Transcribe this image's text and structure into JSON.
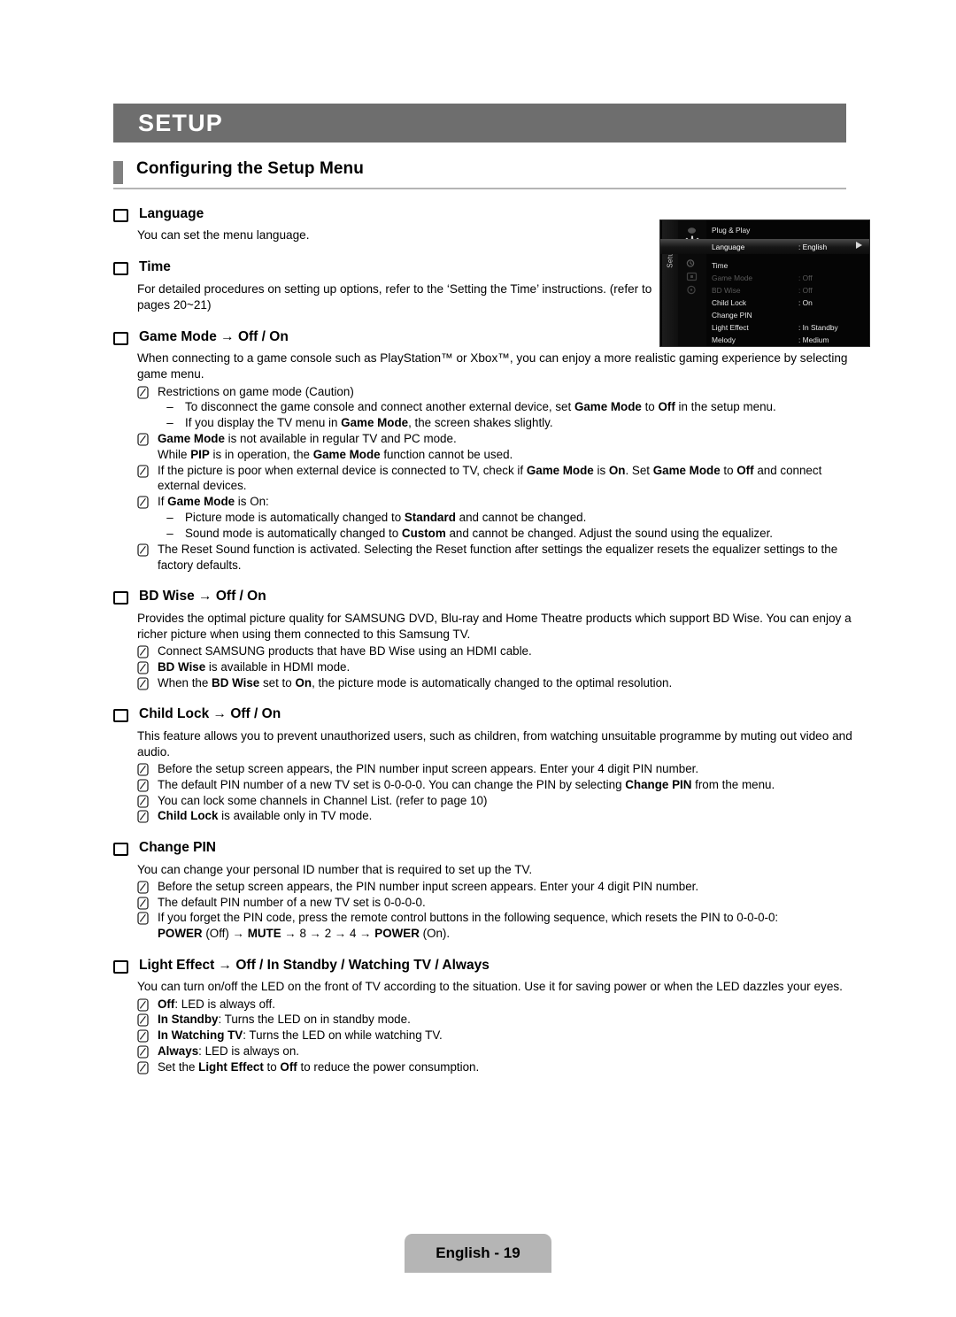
{
  "chapter": {
    "title": "SETUP"
  },
  "section": {
    "title": "Configuring the Setup Menu"
  },
  "footer": {
    "page_label": "English - 19"
  },
  "osd": {
    "tab_label": "Setup",
    "rows": [
      {
        "label": "Plug & Play",
        "value": "",
        "state": "normal"
      },
      {
        "label": "Language",
        "value": ": English",
        "state": "selected"
      },
      {
        "label": "Time",
        "value": "",
        "state": "normal"
      },
      {
        "label": "Game Mode",
        "value": ": Off",
        "state": "dim"
      },
      {
        "label": "BD Wise",
        "value": ": Off",
        "state": "dim"
      },
      {
        "label": "Child Lock",
        "value": ": On",
        "state": "normal"
      },
      {
        "label": "Change PIN",
        "value": "",
        "state": "normal"
      },
      {
        "label": "Light Effect",
        "value": ": In Standby",
        "state": "normal"
      },
      {
        "label": "Melody",
        "value": ": Medium",
        "state": "normal"
      }
    ]
  },
  "items": {
    "language": {
      "heading": "Language",
      "para": "You can set the menu language."
    },
    "time": {
      "heading": "Time",
      "para": "For detailed procedures on setting up options, refer to the ‘Setting the Time’ instructions. (refer to pages 20~21)"
    },
    "game_mode": {
      "heading": "Game Mode → Off / On",
      "para": "When connecting to a game console such as PlayStation™ or Xbox™, you can enjoy a more realistic gaming experience by selecting game menu.",
      "note1": "Restrictions on game mode (Caution)",
      "dash1": "To disconnect the game console and connect another external device, set Game Mode to Off in the setup menu.",
      "dash2": "If you display the TV menu in Game Mode, the screen shakes slightly.",
      "note2": "Game Mode is not available in regular TV and PC mode.",
      "note2b": "While PIP is in operation, the Game Mode function cannot be used.",
      "note3": "If the picture is poor when external device is connected to TV, check if Game Mode is On. Set Game Mode to Off and connect external devices.",
      "note4": "If Game Mode is On:",
      "dash3": "Picture mode is automatically changed to Standard and cannot be changed.",
      "dash4": "Sound mode is automatically changed to Custom and cannot be changed. Adjust the sound using the equalizer.",
      "note5": "The Reset Sound function is activated. Selecting the Reset function after settings the equalizer resets the equalizer settings to the factory defaults."
    },
    "bd_wise": {
      "heading": "BD Wise → Off / On",
      "para": "Provides the optimal picture quality for SAMSUNG DVD, Blu-ray and Home Theatre products which support BD Wise. You can enjoy a richer picture when using them connected to this Samsung TV.",
      "note1": "Connect SAMSUNG products that have BD Wise using an HDMI cable.",
      "note2": "BD Wise is available in HDMI mode.",
      "note3": "When the BD Wise set to On, the picture mode is automatically changed to the optimal resolution."
    },
    "child_lock": {
      "heading": "Child Lock → Off / On",
      "para": "This feature allows you to prevent unauthorized users, such as children, from watching unsuitable programme by muting out video and audio.",
      "note1": "Before the setup screen appears, the PIN number input screen appears. Enter your 4 digit PIN number.",
      "note2": "The default PIN number of a new TV set is 0-0-0-0. You can change the PIN by selecting Change PIN from the menu.",
      "note3": "You can lock some channels in Channel List. (refer to page 10)",
      "note4": "Child Lock is available only in TV mode."
    },
    "change_pin": {
      "heading": "Change PIN",
      "para": "You can change your personal ID number that is required to set up the TV.",
      "note1": "Before the setup screen appears, the PIN number input screen appears. Enter your 4 digit PIN number.",
      "note2": "The default PIN number of a new TV set is 0-0-0-0.",
      "note3": "If you forget the PIN code, press the remote control buttons in the following sequence, which resets the PIN to 0-0-0-0:",
      "note3b": "POWER (Off) → MUTE → 8 → 2 → 4 → POWER (On)."
    },
    "light_effect": {
      "heading": "Light Effect → Off / In Standby / Watching TV / Always",
      "para": "You can turn on/off the LED on the front of TV according to the situation. Use it for saving power or when the LED dazzles your eyes.",
      "note1": "Off: LED is always off.",
      "note2": "In Standby: Turns the LED on in standby mode.",
      "note3": "In Watching TV: Turns the LED on while watching TV.",
      "note4": "Always: LED is always on.",
      "note5": "Set the Light Effect to Off to reduce the power consumption."
    }
  }
}
